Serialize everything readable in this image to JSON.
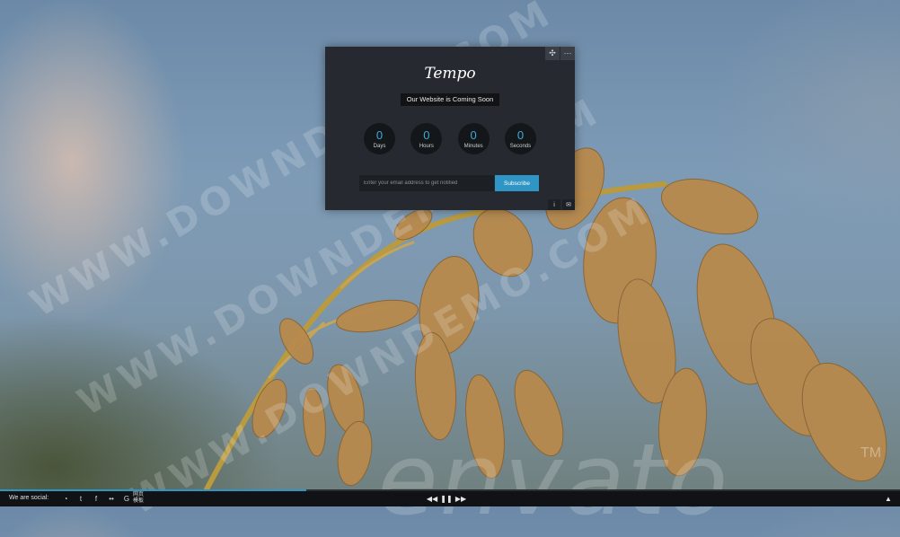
{
  "watermark": {
    "text": "WWW.DOWNDEMO.COM",
    "brand": "envato",
    "trademark": "TM"
  },
  "card": {
    "logo": "Tempo",
    "headline": "Our Website is Coming Soon",
    "tools": [
      {
        "icon": "move-icon",
        "glyph": "✣"
      },
      {
        "icon": "more-icon",
        "glyph": "⋯"
      }
    ],
    "countdown": [
      {
        "value": "0",
        "label": "Days"
      },
      {
        "value": "0",
        "label": "Hours"
      },
      {
        "value": "0",
        "label": "Minutes"
      },
      {
        "value": "0",
        "label": "Seconds"
      }
    ],
    "email_placeholder": "Enter your email address to get notified",
    "subscribe_label": "Subscribe",
    "footer_icons": [
      {
        "icon": "info-icon",
        "glyph": "i"
      },
      {
        "icon": "mail-icon",
        "glyph": "✉"
      }
    ]
  },
  "bottom_bar": {
    "social_label": "We are social:",
    "social_icons": [
      {
        "icon": "rss-icon",
        "glyph": "◔"
      },
      {
        "icon": "twitter-icon",
        "glyph": "t"
      },
      {
        "icon": "facebook-icon",
        "glyph": "f"
      },
      {
        "icon": "flickr-icon",
        "glyph": "••"
      },
      {
        "icon": "google-icon",
        "glyph": "G"
      }
    ],
    "cn_text": "网页 模板",
    "player": [
      {
        "icon": "previous-icon",
        "glyph": "◀◀"
      },
      {
        "icon": "pause-icon",
        "glyph": "❚❚"
      },
      {
        "icon": "next-icon",
        "glyph": "▶▶"
      }
    ],
    "up_icon": {
      "icon": "arrow-up-icon",
      "glyph": "▲"
    },
    "progress": 0.34,
    "accent": "#2f95c4"
  }
}
